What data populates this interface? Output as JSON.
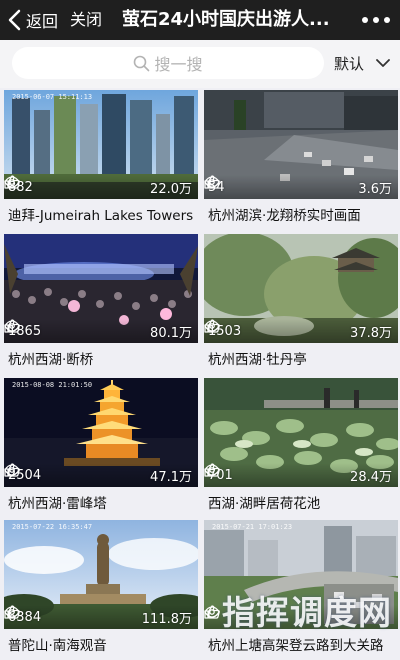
{
  "nav": {
    "back_label": "返回",
    "close_label": "关闭",
    "title": "萤石24小时国庆出游人...",
    "more_icon": "more-dots-icon"
  },
  "search": {
    "placeholder": "搜一搜",
    "sort_label": "默认"
  },
  "cards": [
    {
      "title": "迪拜-Jumeirah Lakes Towers",
      "likes": "882",
      "views": "22.0万",
      "stamp": "2015-06-07 15:11:13"
    },
    {
      "title": "杭州湖滨·龙翔桥实时画面",
      "likes": "54",
      "views": "3.6万",
      "stamp": ""
    },
    {
      "title": "杭州西湖·断桥",
      "likes": "1865",
      "views": "80.1万",
      "stamp": ""
    },
    {
      "title": "杭州西湖·牡丹亭",
      "likes": "1503",
      "views": "37.8万",
      "stamp": ""
    },
    {
      "title": "杭州西湖·雷峰塔",
      "likes": "2504",
      "views": "47.1万",
      "stamp": "2015-08-08 21:01:50"
    },
    {
      "title": "西湖·湖畔居荷花池",
      "likes": "701",
      "views": "28.4万",
      "stamp": ""
    },
    {
      "title": "普陀山·南海观音",
      "likes": "6384",
      "views": "111.8万",
      "stamp": "2015-07-22 16:35:47"
    },
    {
      "title": "杭州上塘高架登云路到大关路",
      "likes": "",
      "views": "",
      "stamp": "2015-07-21 17:01:23"
    }
  ],
  "watermark": "指挥调度网",
  "colors": {
    "navbar": "#1f1f1f",
    "background": "#efeff4"
  }
}
